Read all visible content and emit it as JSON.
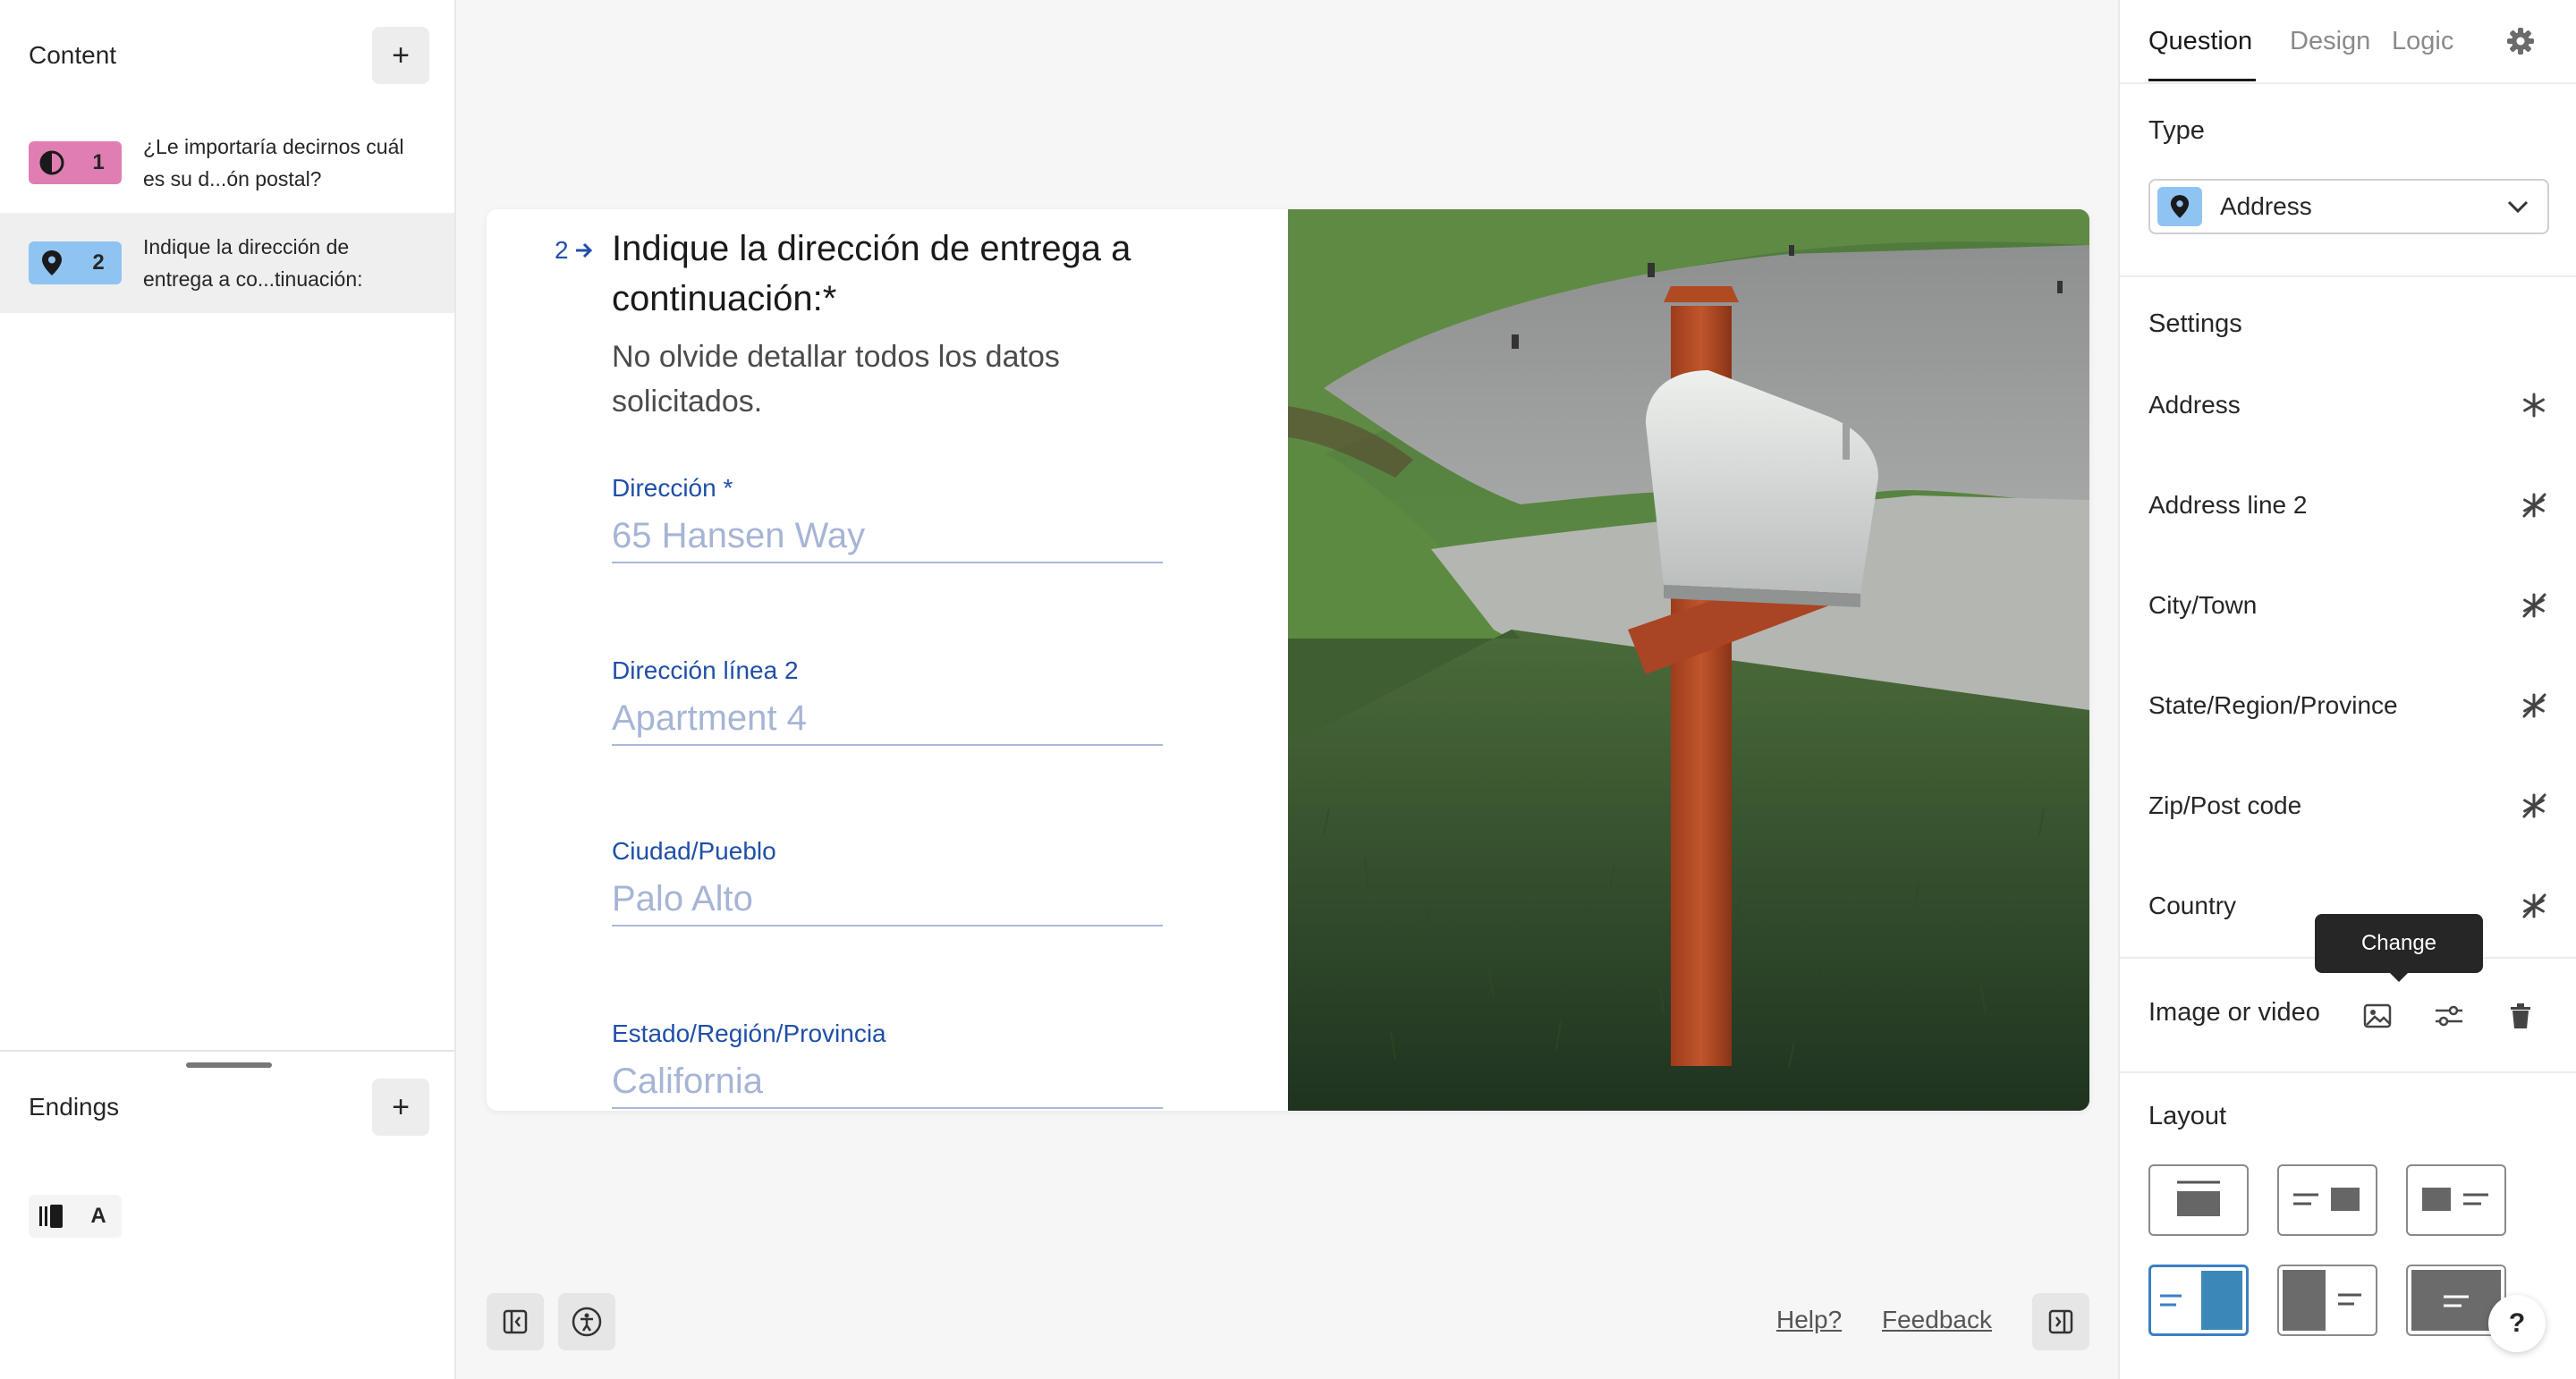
{
  "sidebar": {
    "content_title": "Content",
    "questions": [
      {
        "number": "1",
        "text": "¿Le importaría decirnos cuál es su d...ón postal?",
        "color": "#e07eb4",
        "icon": "contrast-icon"
      },
      {
        "number": "2",
        "text": "Indique la dirección de entrega a co...tinuación:",
        "color": "#8fc4f2",
        "icon": "location-pin-icon"
      }
    ],
    "endings_title": "Endings",
    "ending": {
      "letter": "A",
      "icon": "ending-icon"
    }
  },
  "form": {
    "question_number": "2",
    "title": "Indique la dirección de entrega a continuación:*",
    "description": "No olvide detallar todos los datos solicitados.",
    "fields": [
      {
        "label": "Dirección *",
        "placeholder": "65 Hansen Way"
      },
      {
        "label": "Dirección línea 2",
        "placeholder": "Apartment 4"
      },
      {
        "label": "Ciudad/Pueblo",
        "placeholder": "Palo Alto"
      },
      {
        "label": "Estado/Región/Provincia",
        "placeholder": "California"
      }
    ],
    "accent_color": "#1f4fa8"
  },
  "bottom": {
    "help_link": "Help?",
    "feedback_link": "Feedback"
  },
  "panel": {
    "tabs": [
      "Question",
      "Design",
      "Logic"
    ],
    "active_tab": "Question",
    "type_title": "Type",
    "type_value": "Address",
    "settings_title": "Settings",
    "settings": [
      {
        "label": "Address",
        "required": true
      },
      {
        "label": "Address line 2",
        "required": false
      },
      {
        "label": "City/Town",
        "required": false
      },
      {
        "label": "State/Region/Province",
        "required": false
      },
      {
        "label": "Zip/Post code",
        "required": false
      },
      {
        "label": "Country",
        "required": false
      }
    ],
    "tooltip": "Change",
    "image_video_label": "Image or video",
    "layout_title": "Layout",
    "help_fab": "?"
  }
}
